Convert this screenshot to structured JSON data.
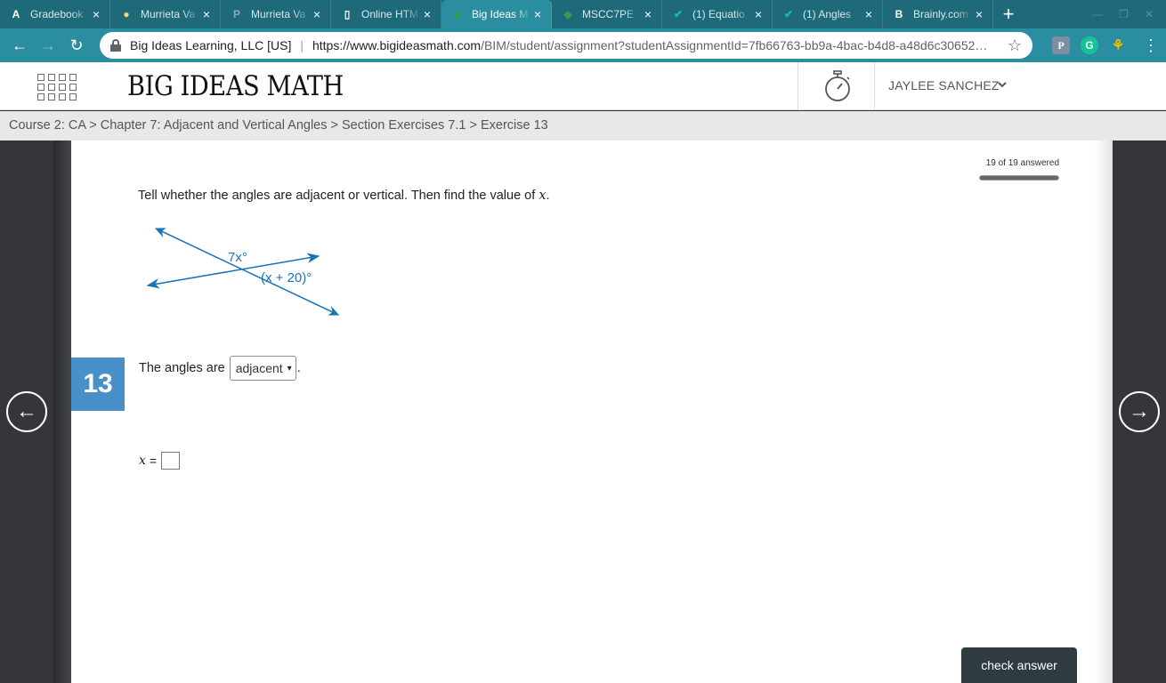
{
  "browser": {
    "tabs": [
      {
        "title": "Gradebook",
        "favicon": "A",
        "favicon_color": "#ffffff",
        "active": false
      },
      {
        "title": "Murrieta Va",
        "favicon": "●",
        "favicon_color": "#f5d76e",
        "active": false
      },
      {
        "title": "Murrieta Va",
        "favicon": "P",
        "favicon_color": "#8fa6b6",
        "active": false
      },
      {
        "title": "Online HTM",
        "favicon": "▯",
        "favicon_color": "#ffffff",
        "active": false
      },
      {
        "title": "Big Ideas M",
        "favicon": "◆",
        "favicon_color": "#2e9c5a",
        "active": true
      },
      {
        "title": "MSCC7PE",
        "favicon": "◆",
        "favicon_color": "#2e9c5a",
        "active": false
      },
      {
        "title": "(1) Equatio",
        "favicon": "✔",
        "favicon_color": "#1dc28f",
        "active": false
      },
      {
        "title": "(1) Angles",
        "favicon": "✔",
        "favicon_color": "#1dc28f",
        "active": false
      },
      {
        "title": "Brainly.com",
        "favicon": "B",
        "favicon_color": "#ffffff",
        "active": false
      }
    ],
    "tab_close_glyph": "×",
    "new_tab_glyph": "+",
    "site_owner": "Big Ideas Learning, LLC [US]",
    "url_host": "https://www.bigideasmath.com",
    "url_path": "/BIM/student/assignment?studentAssignmentId=7fb66763-bb9a-4bac-b4d8-a48d6c30652…",
    "extensions": {
      "p": "P",
      "g": "G",
      "k": "⚘"
    }
  },
  "header": {
    "logo": "BIG IDEAS MATH",
    "user_name": "JAYLEE SANCHEZ"
  },
  "breadcrumb": "Course 2: CA > Chapter 7: Adjacent and Vertical Angles > Section Exercises 7.1 > Exercise 13",
  "progress": {
    "label": "19 of 19 answered",
    "answered": 19,
    "total": 19
  },
  "question": {
    "number": "13",
    "prompt_prefix": "Tell whether the angles are adjacent or vertical. Then find the value of ",
    "variable": "x",
    "prompt_suffix": ".",
    "figure": {
      "label_a": "7x°",
      "label_b": "(x + 20)°",
      "line_color": "#1a73b5"
    },
    "answer_prefix": "The angles are",
    "select_value": "adjacent",
    "select_caret": "▾",
    "answer_suffix": ".",
    "x_equals": "=",
    "x_value": ""
  },
  "buttons": {
    "check_answer": "check answer",
    "prev": "←",
    "next": "→"
  },
  "colors": {
    "tabstrip": "#1e6a7a",
    "toolbar": "#2a8ea0",
    "question_badge": "#4a90c8",
    "check_button": "#2f3a41"
  }
}
